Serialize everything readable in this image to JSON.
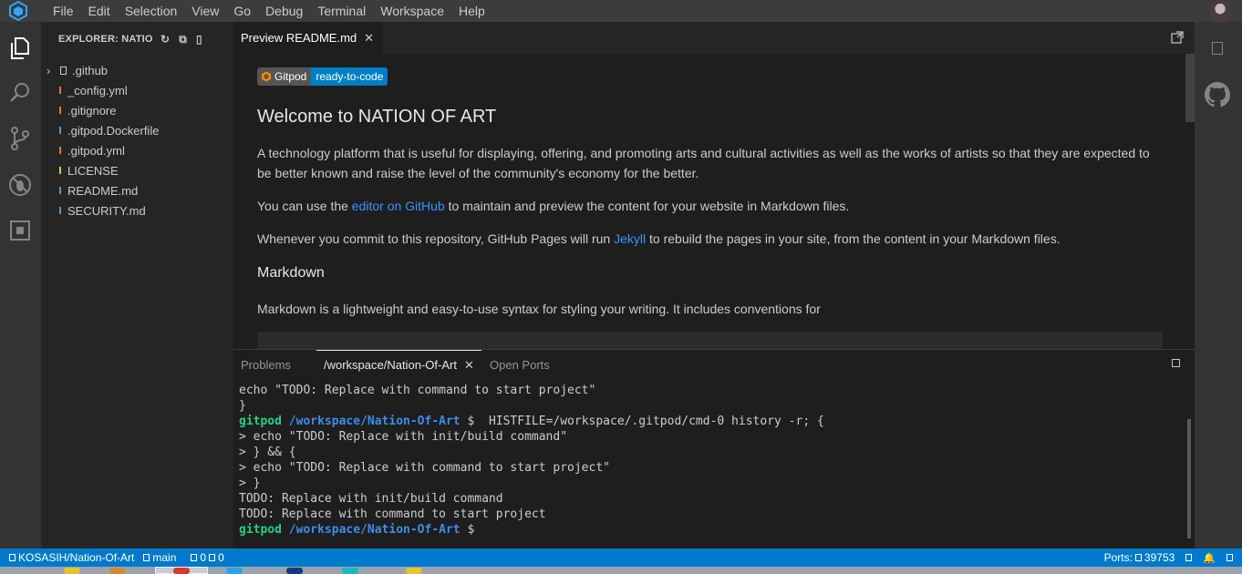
{
  "menu": [
    "File",
    "Edit",
    "Selection",
    "View",
    "Go",
    "Debug",
    "Terminal",
    "Workspace",
    "Help"
  ],
  "sidebar": {
    "title": "EXPLORER: NATION-OF-ART",
    "items": [
      {
        "label": ".github",
        "type": "folder"
      },
      {
        "label": "_config.yml",
        "type": "file",
        "color": "#e37933"
      },
      {
        "label": ".gitignore",
        "type": "file",
        "color": "#e37933"
      },
      {
        "label": ".gitpod.Dockerfile",
        "type": "file",
        "color": "#519aba"
      },
      {
        "label": ".gitpod.yml",
        "type": "file",
        "color": "#e37933"
      },
      {
        "label": "LICENSE",
        "type": "file",
        "color": "#cbcb41"
      },
      {
        "label": "README.md",
        "type": "file",
        "color": "#519aba"
      },
      {
        "label": "SECURITY.md",
        "type": "file",
        "color": "#519aba"
      }
    ]
  },
  "editor": {
    "tab_label": "Preview README.md",
    "badge_left": "Gitpod",
    "badge_right": "ready-to-code",
    "heading": "Welcome to NATION OF ART",
    "para1": "A technology platform that is useful for displaying, offering, and promoting arts and cultural activities as well as the works of artists so that they are expected to be better known and raise the level of the community's economy for the better.",
    "para2_pre": "You can use the ",
    "para2_link": "editor on GitHub",
    "para2_post": " to maintain and preview the content for your website in Markdown files.",
    "para3_pre": "Whenever you commit to this repository, GitHub Pages will run ",
    "para3_link": "Jekyll",
    "para3_post": " to rebuild the pages in your site, from the content in your Markdown files.",
    "subheading": "Markdown",
    "para4": "Markdown is a lightweight and easy-to-use syntax for styling your writing. It includes conventions for"
  },
  "panel": {
    "tabs": [
      "Problems",
      "/workspace/Nation-Of-Art",
      "Open Ports"
    ],
    "terminal": {
      "l1": "echo \"TODO: Replace with command to start project\"",
      "l2": "}",
      "prompt_user": "gitpod",
      "prompt_path": "/workspace/Nation-Of-Art",
      "prompt_sym": " $ ",
      "l3_cmd": " HISTFILE=/workspace/.gitpod/cmd-0 history -r; {",
      "l4": "> echo \"TODO: Replace with init/build command\"",
      "l5": "> } && {",
      "l6": "> echo \"TODO: Replace with command to start project\"",
      "l7": "> }",
      "l8": "TODO: Replace with init/build command",
      "l9": "TODO: Replace with command to start project",
      "last_sym": " $"
    }
  },
  "status": {
    "repo": "KOSASIH/Nation-Of-Art",
    "branch": "main",
    "problems": "0",
    "warnings": "0",
    "ports": "Ports: ",
    "port": "39753"
  }
}
